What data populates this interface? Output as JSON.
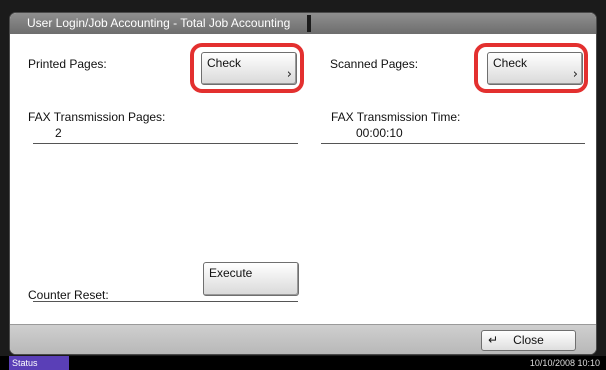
{
  "header": {
    "title": "User Login/Job Accounting - Total Job Accounting"
  },
  "printed_pages": {
    "label": "Printed Pages:",
    "button_label": "Check"
  },
  "scanned_pages": {
    "label": "Scanned Pages:",
    "button_label": "Check"
  },
  "fax_pages": {
    "label": "FAX Transmission Pages:",
    "value": "2"
  },
  "fax_time": {
    "label": "FAX Transmission Time:",
    "value": "00:00:10"
  },
  "counter_reset": {
    "label": "Counter Reset:",
    "button_label": "Execute"
  },
  "footer": {
    "close_label": "Close"
  },
  "status_bar": {
    "status_label": "Status",
    "datetime": "10/10/2008   10:10"
  },
  "colors": {
    "highlight": "#e3302f",
    "status_accent": "#5a3fb7",
    "header_bg": "#7d7d7d"
  },
  "icons": {
    "check_chevron": "chevron-right-icon",
    "close_icon": "enter-return-icon"
  }
}
